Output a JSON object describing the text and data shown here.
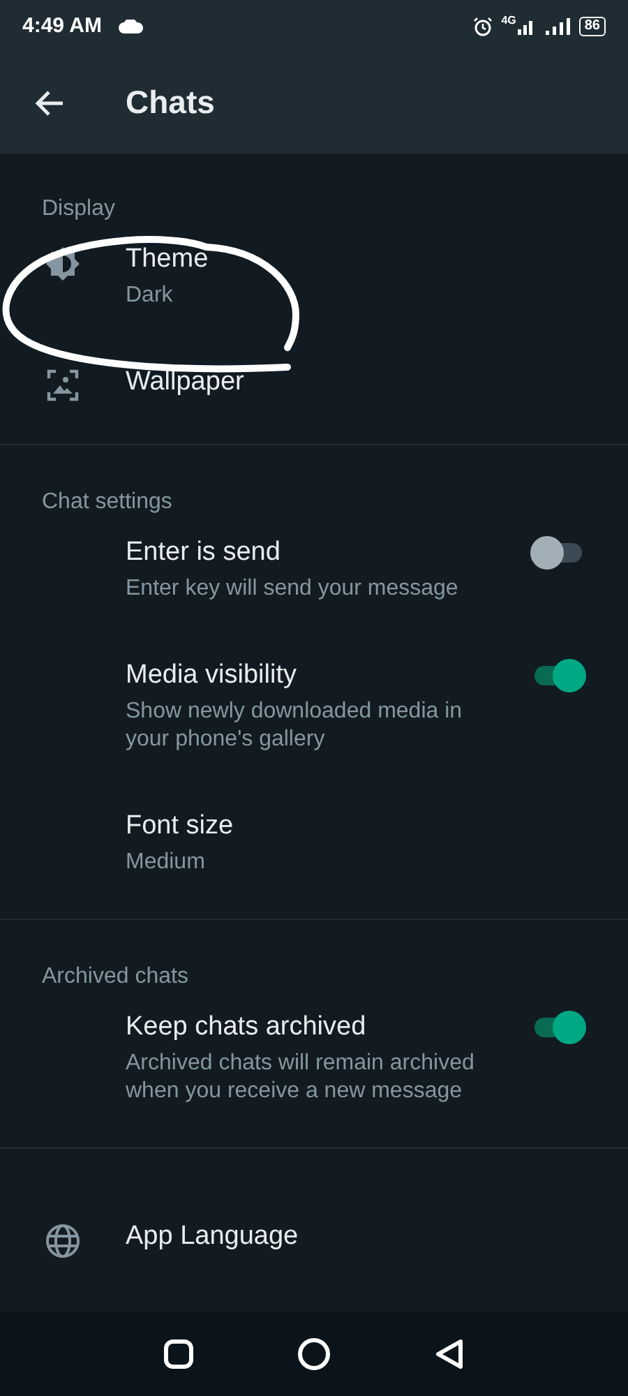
{
  "status_bar": {
    "time": "4:49 AM",
    "network": "4G",
    "battery": "86"
  },
  "header": {
    "title": "Chats"
  },
  "sections": [
    {
      "title": "Display",
      "items": [
        {
          "kind": "link",
          "title": "Theme",
          "subtitle": "Dark"
        },
        {
          "kind": "link",
          "title": "Wallpaper"
        }
      ]
    },
    {
      "title": "Chat settings",
      "items": [
        {
          "kind": "toggle",
          "title": "Enter is send",
          "subtitle": "Enter key will send your message",
          "on": false
        },
        {
          "kind": "toggle",
          "title": "Media visibility",
          "subtitle": "Show newly downloaded media in your phone's gallery",
          "on": true
        },
        {
          "kind": "link",
          "title": "Font size",
          "subtitle": "Medium"
        }
      ]
    },
    {
      "title": "Archived chats",
      "items": [
        {
          "kind": "toggle",
          "title": "Keep chats archived",
          "subtitle": "Archived chats will remain archived when you receive a new message",
          "on": true
        }
      ]
    },
    {
      "items": [
        {
          "kind": "link",
          "title": "App Language"
        }
      ]
    }
  ]
}
